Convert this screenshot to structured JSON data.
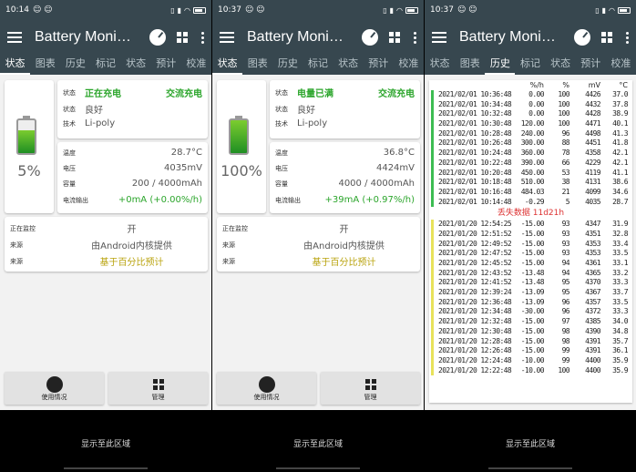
{
  "colors": {
    "toolbar": "#37474f",
    "green": "#2ba52b",
    "yellow": "#b9a30d",
    "history_bar_green": "#3cbc52",
    "history_bar_yellow": "#e8e25a",
    "lost_red": "#dd3333"
  },
  "panels": [
    {
      "status_time": "10:14",
      "app_title": "Battery Moni…",
      "tabs": [
        "状态",
        "图表",
        "历史",
        "标记",
        "状态",
        "预计",
        "校准"
      ],
      "active_tab": 0,
      "battery_percent": "5%",
      "battery_level": 0.05,
      "info": {
        "status_label": "状态",
        "status_value": "正在充电",
        "source_value": "交流充电",
        "health_label": "状态",
        "health_value": "良好",
        "tech_label": "技术",
        "tech_value": "Li-poly"
      },
      "metrics": {
        "temp_label": "温度",
        "temp_value": "28.7°C",
        "voltage_label": "电压",
        "voltage_value": "4035mV",
        "capacity_label": "容量",
        "capacity_value": "200 / 4000mAh",
        "current_label": "电流输出",
        "current_value": "+0mA (+0.00%/h)"
      },
      "monitor": {
        "monitoring_label": "正在监控",
        "monitoring_value": "开",
        "source1_label": "来源",
        "source1_value": "由Android内核提供",
        "source2_label": "来源",
        "source2_value": "基于百分比预计"
      },
      "buttons": {
        "usage": "使用情况",
        "manage": "管理"
      },
      "nav_text": "显示至此区域"
    },
    {
      "status_time": "10:37",
      "app_title": "Battery Moni…",
      "tabs": [
        "状态",
        "图表",
        "历史",
        "标记",
        "状态",
        "预计",
        "校准"
      ],
      "active_tab": 0,
      "battery_percent": "100%",
      "battery_level": 1.0,
      "info": {
        "status_label": "状态",
        "status_value": "电量已满",
        "source_value": "交流充电",
        "health_label": "状态",
        "health_value": "良好",
        "tech_label": "技术",
        "tech_value": "Li-poly"
      },
      "metrics": {
        "temp_label": "温度",
        "temp_value": "36.8°C",
        "voltage_label": "电压",
        "voltage_value": "4424mV",
        "capacity_label": "容量",
        "capacity_value": "4000 / 4000mAh",
        "current_label": "电流输出",
        "current_value": "+39mA (+0.97%/h)"
      },
      "monitor": {
        "monitoring_label": "正在监控",
        "monitoring_value": "开",
        "source1_label": "来源",
        "source1_value": "由Android内核提供",
        "source2_label": "来源",
        "source2_value": "基于百分比预计"
      },
      "buttons": {
        "usage": "使用情况",
        "manage": "管理"
      },
      "nav_text": "显示至此区域"
    },
    {
      "status_time": "10:37",
      "app_title": "Battery Moni…",
      "tabs": [
        "状态",
        "图表",
        "历史",
        "标记",
        "状态",
        "预计",
        "校准"
      ],
      "active_tab": 2,
      "history": {
        "headers": [
          "%/h",
          "%",
          "mV",
          "°C"
        ],
        "group1": [
          [
            "2021/02/01 10:36:48",
            "0.00",
            "100",
            "4426",
            "37.0"
          ],
          [
            "2021/02/01 10:34:48",
            "0.00",
            "100",
            "4432",
            "37.8"
          ],
          [
            "2021/02/01 10:32:48",
            "0.00",
            "100",
            "4428",
            "38.9"
          ],
          [
            "2021/02/01 10:30:48",
            "120.00",
            "100",
            "4471",
            "40.1"
          ],
          [
            "2021/02/01 10:28:48",
            "240.00",
            "96",
            "4498",
            "41.3"
          ],
          [
            "2021/02/01 10:26:48",
            "300.00",
            "88",
            "4451",
            "41.8"
          ],
          [
            "2021/02/01 10:24:48",
            "360.00",
            "78",
            "4358",
            "42.1"
          ],
          [
            "2021/02/01 10:22:48",
            "390.00",
            "66",
            "4229",
            "42.1"
          ],
          [
            "2021/02/01 10:20:48",
            "450.00",
            "53",
            "4119",
            "41.1"
          ],
          [
            "2021/02/01 10:18:48",
            "510.00",
            "38",
            "4131",
            "38.6"
          ],
          [
            "2021/02/01 10:16:48",
            "484.03",
            "21",
            "4099",
            "34.6"
          ],
          [
            "2021/02/01 10:14:48",
            "-0.29",
            "5",
            "4035",
            "28.7"
          ]
        ],
        "lost_text": "丢失数据 11d21h",
        "group2": [
          [
            "2021/01/20 12:54:25",
            "-15.00",
            "93",
            "4347",
            "31.9"
          ],
          [
            "2021/01/20 12:51:52",
            "-15.00",
            "93",
            "4351",
            "32.8"
          ],
          [
            "2021/01/20 12:49:52",
            "-15.00",
            "93",
            "4353",
            "33.4"
          ],
          [
            "2021/01/20 12:47:52",
            "-15.00",
            "93",
            "4353",
            "33.5"
          ],
          [
            "2021/01/20 12:45:52",
            "-15.00",
            "94",
            "4361",
            "33.1"
          ],
          [
            "2021/01/20 12:43:52",
            "-13.48",
            "94",
            "4365",
            "33.2"
          ],
          [
            "2021/01/20 12:41:52",
            "-13.48",
            "95",
            "4370",
            "33.3"
          ],
          [
            "2021/01/20 12:39:24",
            "-13.09",
            "95",
            "4367",
            "33.7"
          ],
          [
            "2021/01/20 12:36:48",
            "-13.09",
            "96",
            "4357",
            "33.5"
          ],
          [
            "2021/01/20 12:34:48",
            "-30.00",
            "96",
            "4372",
            "33.3"
          ],
          [
            "2021/01/20 12:32:48",
            "-15.00",
            "97",
            "4385",
            "34.0"
          ],
          [
            "2021/01/20 12:30:48",
            "-15.00",
            "98",
            "4390",
            "34.8"
          ],
          [
            "2021/01/20 12:28:48",
            "-15.00",
            "98",
            "4391",
            "35.7"
          ],
          [
            "2021/01/20 12:26:48",
            "-15.00",
            "99",
            "4391",
            "36.1"
          ],
          [
            "2021/01/20 12:24:48",
            "-10.00",
            "99",
            "4400",
            "35.9"
          ],
          [
            "2021/01/20 12:22:48",
            "-10.00",
            "100",
            "4400",
            "35.9"
          ]
        ]
      },
      "nav_text": "显示至此区域"
    }
  ]
}
